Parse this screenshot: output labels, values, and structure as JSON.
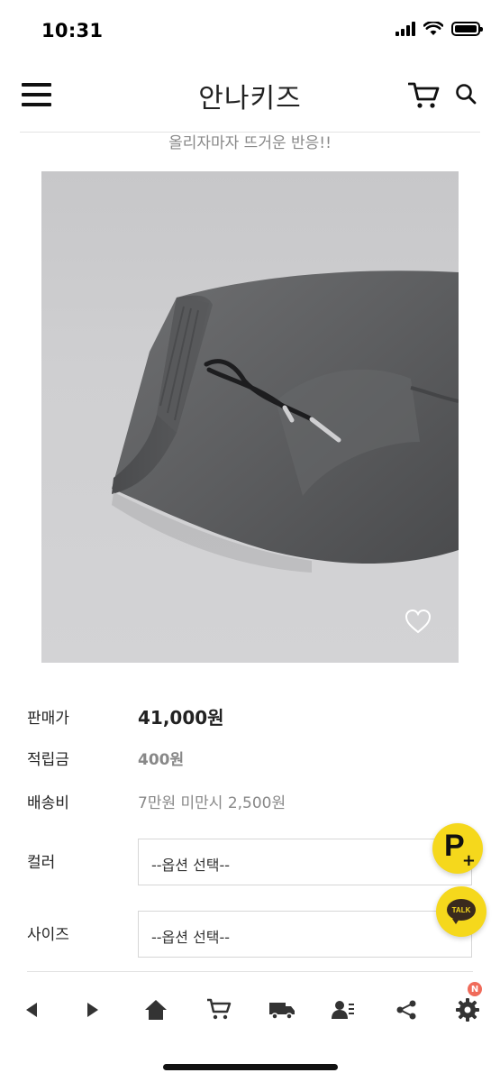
{
  "status_bar": {
    "time": "10:31"
  },
  "header": {
    "logo": "안나키즈"
  },
  "subtitle": "올리자마자 뜨거운 반응!!",
  "product": {
    "image_alt": "charcoal jogger pants waistband"
  },
  "info": {
    "price_label": "판매가",
    "price_value": "41,000원",
    "points_label": "적립금",
    "points_value": "400원",
    "shipping_label": "배송비",
    "shipping_value": "7만원 미만시 2,500원"
  },
  "options": {
    "color_label": "컬러",
    "color_value": "--옵션 선택--",
    "size_label": "사이즈",
    "size_value": "--옵션 선택--"
  },
  "floating": {
    "point_letter": "P",
    "point_plus": "+",
    "talk_label": "TALK"
  },
  "bottom_nav": {
    "badge": "N",
    "icons": [
      "back-icon",
      "forward-icon",
      "home-icon",
      "cart-icon",
      "delivery-truck-icon",
      "user-profile-icon",
      "share-icon",
      "gear-icon"
    ]
  },
  "colors": {
    "accent_yellow": "#f5d81c",
    "badge_red": "#f06b5a",
    "muted_text": "#888888"
  }
}
